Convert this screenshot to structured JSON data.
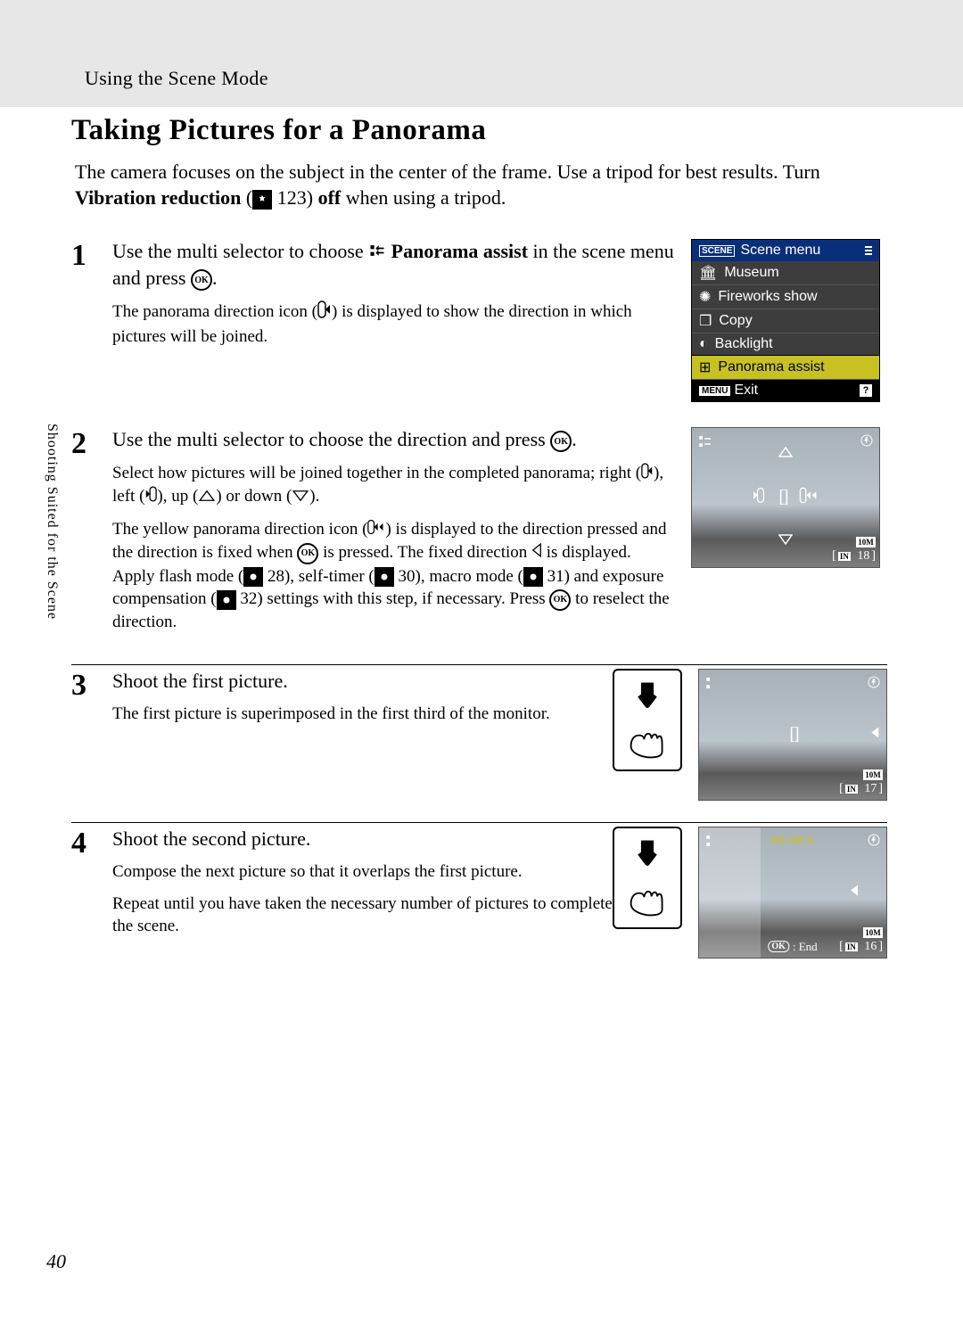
{
  "header": {
    "section": "Using the Scene Mode"
  },
  "title": "Taking Pictures for a Panorama",
  "intro": {
    "line1": "The camera focuses on the subject in the center of the frame. Use a tripod for best results. Turn ",
    "vr": "Vibration reduction",
    "paren_open": " (",
    "vr_ref": " 123) ",
    "off": "off",
    "tail": " when using a tripod."
  },
  "steps": {
    "s1": {
      "num": "1",
      "t1": "Use the multi selector to choose ",
      "t2": "Panorama assist",
      "t3": " in the scene menu and press ",
      "t4": ".",
      "d1": "The panorama direction icon (",
      "d2": ") is displayed to show the direction in which pictures will be joined."
    },
    "s2": {
      "num": "2",
      "t1": "Use the multi selector to choose the direction and press ",
      "t2": ".",
      "d1": "Select how pictures will be joined together in the completed panorama; right (",
      "d2": "), left (",
      "d3": "), up (",
      "d4": ") or down (",
      "d5": ").",
      "e1": "The yellow panorama direction icon (",
      "e2": ") is displayed to the direction pressed and the direction is fixed when ",
      "e3": " is pressed. The fixed direction ",
      "e4": " is displayed. Apply flash mode (",
      "e5": " 28), self-timer (",
      "e6": " 30), macro mode (",
      "e7": " 31) and exposure compensation (",
      "e8": " 32) settings with this step, if necessary. Press ",
      "e9": " to reselect the direction."
    },
    "s3": {
      "num": "3",
      "t": "Shoot the first picture.",
      "d": "The first picture is superimposed in the first third of the monitor."
    },
    "s4": {
      "num": "4",
      "t": "Shoot the second picture.",
      "d1": "Compose the next picture so that it overlaps the first picture.",
      "d2": "Repeat until you have taken the necessary number of pictures to complete the scene."
    }
  },
  "menu": {
    "title": "Scene menu",
    "items": [
      "Museum",
      "Fireworks show",
      "Copy",
      "Backlight",
      "Panorama assist"
    ],
    "exit": "Exit",
    "menu_btn": "MENU",
    "scene_badge": "SCENE"
  },
  "cam": {
    "tenm": "10M",
    "in": "IN",
    "c1": "18",
    "c3": "17",
    "c4": "16",
    "aeaf": "AE/AF-L",
    "ok": "OK",
    "end": ": End"
  },
  "sidebar": "Shooting Suited for the Scene",
  "page_number": "40"
}
